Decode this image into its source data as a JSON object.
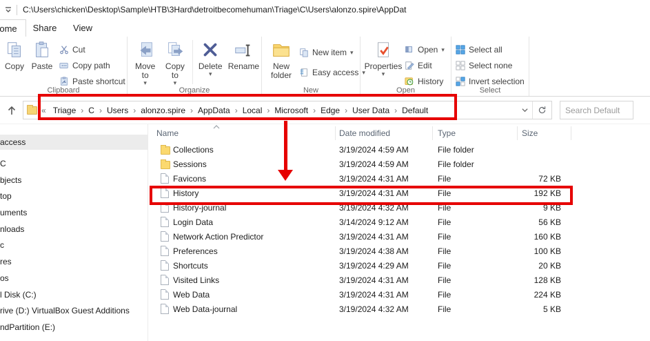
{
  "titlebar": {
    "path": "C:\\Users\\chicken\\Desktop\\Sample\\HTB\\3Hard\\detroitbecomehuman\\Triage\\C\\Users\\alonzo.spire\\AppDat"
  },
  "tabs": {
    "home": "ome",
    "share": "Share",
    "view": "View"
  },
  "ribbon": {
    "clipboard": {
      "label": "Clipboard",
      "copy": "Copy",
      "paste": "Paste",
      "cut": "Cut",
      "copy_path": "Copy path",
      "paste_shortcut": "Paste shortcut"
    },
    "organize": {
      "label": "Organize",
      "move_to": "Move to",
      "copy_to": "Copy to",
      "delete": "Delete",
      "rename": "Rename"
    },
    "new_group": {
      "label": "New",
      "new_folder": "New folder",
      "new_item": "New item",
      "easy_access": "Easy access"
    },
    "open_group": {
      "label": "Open",
      "properties": "Properties",
      "open": "Open",
      "edit": "Edit",
      "history": "History"
    },
    "select_group": {
      "label": "Select",
      "select_all": "Select all",
      "select_none": "Select none",
      "invert_selection": "Invert selection"
    }
  },
  "addressbar": {
    "collapsed_indicator": "«",
    "crumbs": [
      "Triage",
      "C",
      "Users",
      "alonzo.spire",
      "AppData",
      "Local",
      "Microsoft",
      "Edge",
      "User Data",
      "Default"
    ],
    "search_placeholder": "Search Default"
  },
  "sidebar": {
    "items": [
      {
        "label": "access",
        "selected": true
      },
      {
        "label": "C",
        "gap": true
      },
      {
        "label": "bjects"
      },
      {
        "label": "top"
      },
      {
        "label": "uments"
      },
      {
        "label": "nloads"
      },
      {
        "label": "c"
      },
      {
        "label": "res"
      },
      {
        "label": "os"
      },
      {
        "label": "l Disk (C:)"
      },
      {
        "label": "rive (D:) VirtualBox Guest Additions"
      },
      {
        "label": "ndPartition (E:)"
      }
    ]
  },
  "filelist": {
    "columns": {
      "name": "Name",
      "date": "Date modified",
      "type": "Type",
      "size": "Size"
    },
    "rows": [
      {
        "name": "Collections",
        "date": "3/19/2024 4:59 AM",
        "type": "File folder",
        "size": "",
        "icon": "folder"
      },
      {
        "name": "Sessions",
        "date": "3/19/2024 4:59 AM",
        "type": "File folder",
        "size": "",
        "icon": "folder"
      },
      {
        "name": "Favicons",
        "date": "3/19/2024 4:31 AM",
        "type": "File",
        "size": "72 KB",
        "icon": "file"
      },
      {
        "name": "History",
        "date": "3/19/2024 4:31 AM",
        "type": "File",
        "size": "192 KB",
        "icon": "file"
      },
      {
        "name": "History-journal",
        "date": "3/19/2024 4:32 AM",
        "type": "File",
        "size": "9 KB",
        "icon": "file"
      },
      {
        "name": "Login Data",
        "date": "3/14/2024 9:12 AM",
        "type": "File",
        "size": "56 KB",
        "icon": "file"
      },
      {
        "name": "Network Action Predictor",
        "date": "3/19/2024 4:31 AM",
        "type": "File",
        "size": "160 KB",
        "icon": "file"
      },
      {
        "name": "Preferences",
        "date": "3/19/2024 4:38 AM",
        "type": "File",
        "size": "100 KB",
        "icon": "file"
      },
      {
        "name": "Shortcuts",
        "date": "3/19/2024 4:29 AM",
        "type": "File",
        "size": "20 KB",
        "icon": "file"
      },
      {
        "name": "Visited Links",
        "date": "3/19/2024 4:31 AM",
        "type": "File",
        "size": "128 KB",
        "icon": "file"
      },
      {
        "name": "Web Data",
        "date": "3/19/2024 4:31 AM",
        "type": "File",
        "size": "224 KB",
        "icon": "file"
      },
      {
        "name": "Web Data-journal",
        "date": "3/19/2024 4:32 AM",
        "type": "File",
        "size": "5 KB",
        "icon": "file"
      }
    ]
  },
  "annotations": {
    "color": "#e60000"
  }
}
